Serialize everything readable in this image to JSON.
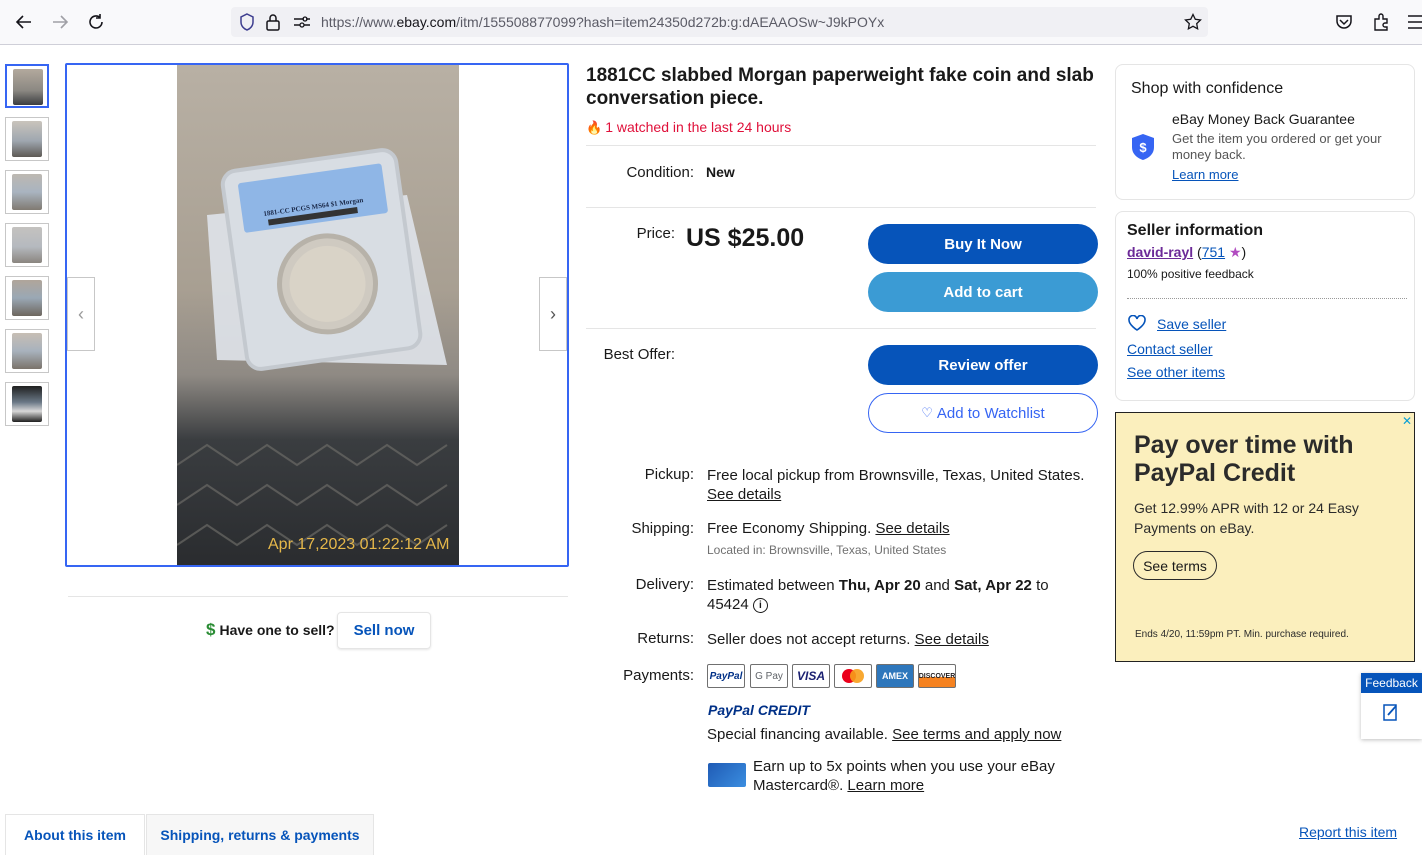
{
  "browser": {
    "url_prefix": "https://www.",
    "url_domain": "ebay.com",
    "url_rest": "/itm/155508877099?hash=item24350d272b:g:dAEAAOSw~J9kPOYx"
  },
  "gallery": {
    "photo_timestamp": "Apr 17,2023 01:22:12 AM",
    "slab_text": "1881-CC  PCGS MS64  $1  Morgan"
  },
  "sell": {
    "question": "Have one to sell?",
    "button": "Sell now"
  },
  "item": {
    "title": "1881CC slabbed Morgan paperweight fake coin and slab conversation piece.",
    "watched": "1 watched in the last 24 hours",
    "condition_label": "Condition:",
    "condition_value": "New",
    "price_label": "Price:",
    "price_value": "US $25.00",
    "buy_now": "Buy It Now",
    "add_to_cart": "Add to cart",
    "best_offer_label": "Best Offer:",
    "review_offer": "Review offer",
    "add_to_watchlist": "Add to Watchlist"
  },
  "details": {
    "pickup_label": "Pickup:",
    "pickup_value": "Free local pickup from Brownsville, Texas, United States.",
    "pickup_link": "See details",
    "shipping_label": "Shipping:",
    "shipping_free": "Free",
    "shipping_value": "Economy Shipping.",
    "shipping_link": "See details",
    "located": "Located in: Brownsville, Texas, United States",
    "delivery_label": "Delivery:",
    "delivery_prefix": "Estimated between",
    "delivery_from": "Thu, Apr 20",
    "delivery_and": "and",
    "delivery_to": "Sat, Apr 22",
    "delivery_suffix": "to",
    "delivery_zip": "45424",
    "returns_label": "Returns:",
    "returns_value": "Seller does not accept returns.",
    "returns_link": "See details",
    "payments_label": "Payments:",
    "payment_methods": [
      "PayPal",
      "G Pay",
      "VISA",
      "Mastercard",
      "AMEX",
      "DISCOVER"
    ],
    "paypal_credit_logo": "PayPal CREDIT",
    "financing_text": "Special financing available.",
    "financing_link": "See terms and apply now",
    "card_text": "Earn up to 5x points when you use your eBay Mastercard®.",
    "card_link": "Learn more"
  },
  "confidence": {
    "heading": "Shop with confidence",
    "guarantee_title": "eBay Money Back Guarantee",
    "guarantee_text": "Get the item you ordered or get your money back.",
    "learn_more": "Learn more"
  },
  "seller": {
    "heading": "Seller information",
    "name": "david-rayl",
    "score": "751",
    "feedback": "100% positive feedback",
    "save_seller": "Save seller",
    "contact_seller": "Contact seller",
    "other_items": "See other items"
  },
  "ad": {
    "headline": "Pay over time with PayPal Credit",
    "body": "Get 12.99% APR with 12 or 24 Easy Payments on eBay.",
    "button": "See terms",
    "fine_print": "Ends 4/20, 11:59pm PT. Min. purchase required."
  },
  "feedback_tab": "Feedback",
  "tabs": [
    "About this item",
    "Shipping, returns & payments"
  ],
  "report": "Report this item",
  "colors": {
    "primary_blue": "#0654ba",
    "cart_blue": "#3b9bd4",
    "watch_red": "#e0103a",
    "ad_bg": "#fbefbd"
  }
}
